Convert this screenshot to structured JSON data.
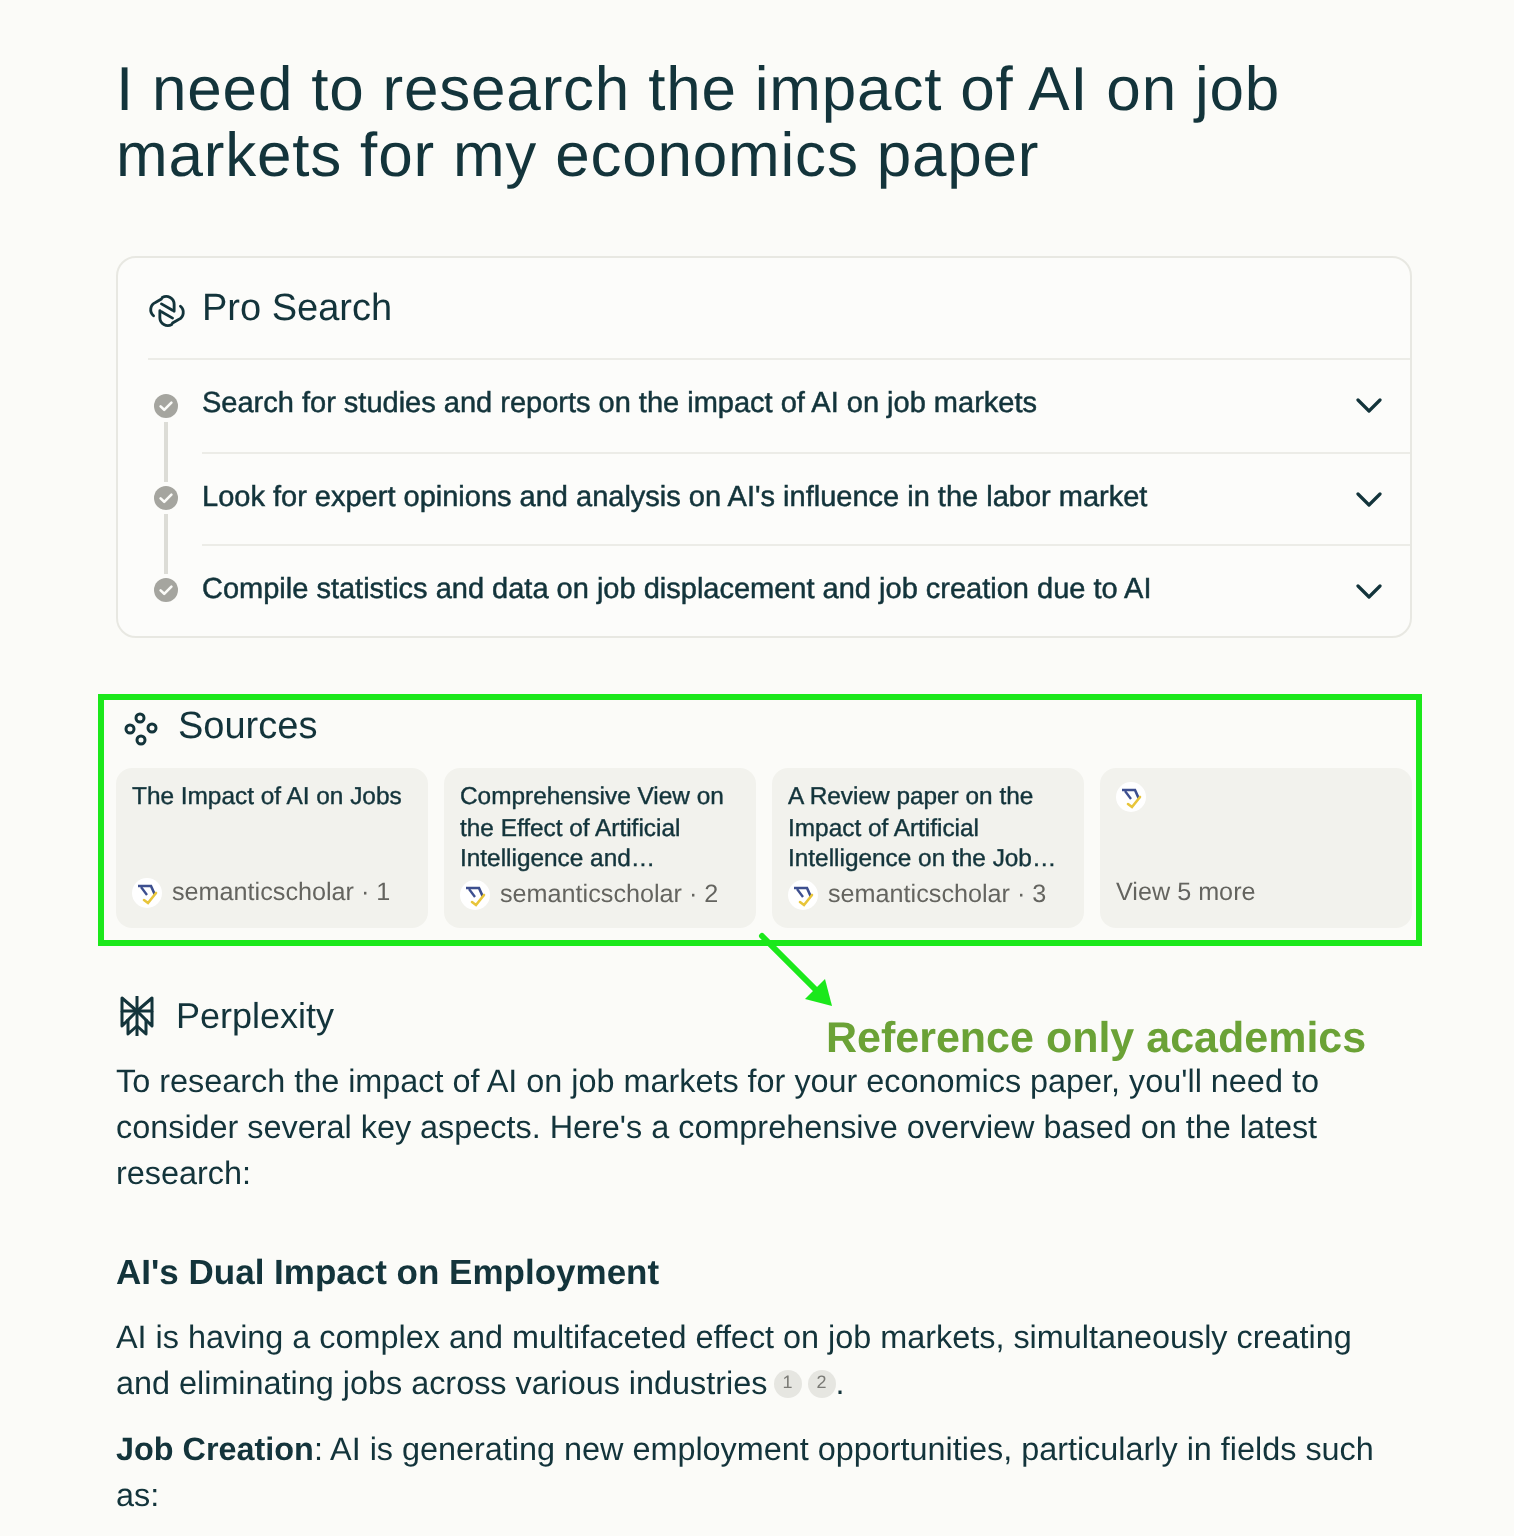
{
  "query": {
    "title": "I need to research the impact of AI on job markets for my economics paper"
  },
  "pro_search": {
    "title": "Pro Search",
    "steps": [
      {
        "text": "Search for studies and reports on the impact of AI on job markets",
        "completed": true,
        "expanded": false
      },
      {
        "text": "Look for expert opinions and analysis on AI's influence in the labor market",
        "completed": true,
        "expanded": false
      },
      {
        "text": "Compile statistics and data on job displacement and job creation due to AI",
        "completed": true,
        "expanded": false
      }
    ]
  },
  "sources": {
    "title": "Sources",
    "items": [
      {
        "kind": "source",
        "title": "The Impact of AI on Jobs",
        "meta": "semanticscholar · 1"
      },
      {
        "kind": "source",
        "title": "Comprehensive View on the Effect of Artificial Intelligence and…",
        "meta": "semanticscholar · 2"
      },
      {
        "kind": "source",
        "title": "A Review paper on the Impact of Artificial Intelligence on the Job…",
        "meta": "semanticscholar · 3"
      },
      {
        "kind": "more",
        "label": "View 5 more"
      }
    ]
  },
  "annotation": {
    "text": "Reference only academics"
  },
  "answer": {
    "title": "Perplexity",
    "intro": "To research the impact of AI on job markets for your economics paper, you'll need to consider several key aspects. Here's a comprehensive overview based on the latest research:",
    "sections": [
      {
        "heading": "AI's Dual Impact on Employment",
        "paragraphs": [
          {
            "text": "AI is having a complex and multifaceted effect on job markets, simultaneously creating and eliminating jobs across various industries",
            "citations": [
              "1",
              "2"
            ],
            "after": "."
          },
          {
            "text": "**Job Creation**: AI is generating new employment opportunities, particularly in fields such as:"
          }
        ]
      }
    ]
  }
}
